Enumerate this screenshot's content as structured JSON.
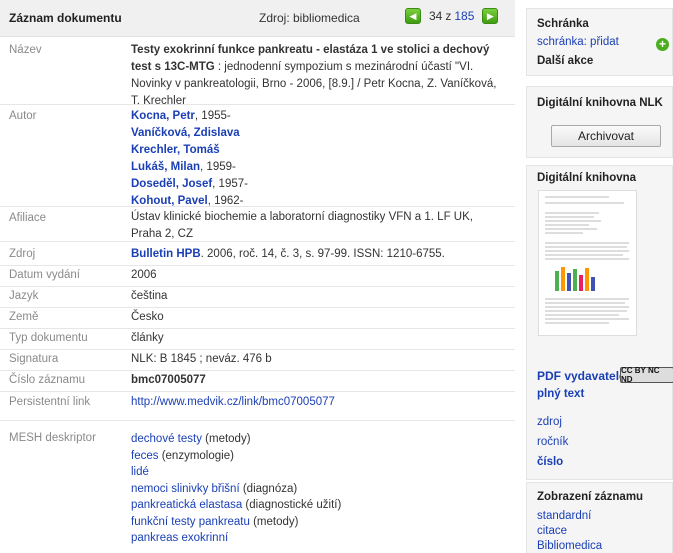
{
  "header": {
    "title": "Záznam dokumentu",
    "source": "Zdroj: bibliomedica",
    "current": "34",
    "of": "z",
    "total": "185"
  },
  "record": {
    "nazev_label": "Název",
    "nazev_bold": "Testy exokrinní funkce pankreatu - elastáza 1 ve stolici a dechový test s 13C-MTG",
    "nazev_rest": " : jednodenní sympozium s mezinárodní účastí \"VI. Novinky v pankreatologii, Brno - 2006, [8.9.] / Petr Kocna, Z. Vaníčková, T. Krechler",
    "autor_label": "Autor",
    "authors": [
      {
        "name": "Kocna, Petr",
        "extra": ", 1955-"
      },
      {
        "name": "Vaníčková, Zdislava",
        "extra": ""
      },
      {
        "name": "Krechler, Tomáš",
        "extra": ""
      },
      {
        "name": "Lukáš, Milan",
        "extra": ", 1959-"
      },
      {
        "name": "Doseděl, Josef",
        "extra": ", 1957-"
      },
      {
        "name": "Kohout, Pavel",
        "extra": ", 1962-"
      }
    ],
    "afiliace_label": "Afiliace",
    "afiliace": "Ústav klinické biochemie a laboratorní diagnostiky VFN a 1. LF UK, Praha 2, CZ",
    "zdroj_label": "Zdroj",
    "zdroj_link": "Bulletin HPB",
    "zdroj_rest": ". 2006, roč. 14, č. 3, s. 97-99. ISSN: 1210-6755.",
    "datum_label": "Datum vydání",
    "datum": "2006",
    "jazyk_label": "Jazyk",
    "jazyk": "čeština",
    "zeme_label": "Země",
    "zeme": "Česko",
    "typ_label": "Typ dokumentu",
    "typ": "články",
    "signatura_label": "Signatura",
    "signatura": "NLK: B 1845 ; neváz. 476 b",
    "cislo_label": "Číslo záznamu",
    "cislo": "bmc07005077",
    "link_label": "Persistentní link",
    "link": "http://www.medvik.cz/link/bmc07005077",
    "mesh_label": "MESH deskriptor",
    "mesh": [
      {
        "term": "dechové testy",
        "qual": " (metody)"
      },
      {
        "term": "feces",
        "qual": " (enzymologie)"
      },
      {
        "term": "lidé",
        "qual": ""
      },
      {
        "term": "nemoci slinivky břišní",
        "qual": " (diagnóza)"
      },
      {
        "term": "pankreatická elastasa",
        "qual": " (diagnostické užití)"
      },
      {
        "term": "funkční testy pankreatu",
        "qual": " (metody)"
      },
      {
        "term": "pankreas exokrinní",
        "qual": ""
      }
    ]
  },
  "sidebar": {
    "schranka_title": "Schránka",
    "schranka_add": "schránka: přidat",
    "dalsi_akce": "Další akce",
    "dk_nlk_title": "Digitální knihovna NLK",
    "archive_button": "Archivovat",
    "dk_title": "Digitální knihovna",
    "pdf_link": "PDF vydavatele",
    "license_badge": "CC BY NC ND",
    "full_text": "plný text",
    "links": [
      "zdroj",
      "ročník",
      "číslo"
    ],
    "view_title": "Zobrazení záznamu",
    "views": [
      "standardní",
      "citace",
      "Bibliomedica"
    ]
  },
  "colors": {
    "link": "#1a3fb5",
    "nav_green": "#4cae1f",
    "label_gray": "#8a8a8a"
  }
}
